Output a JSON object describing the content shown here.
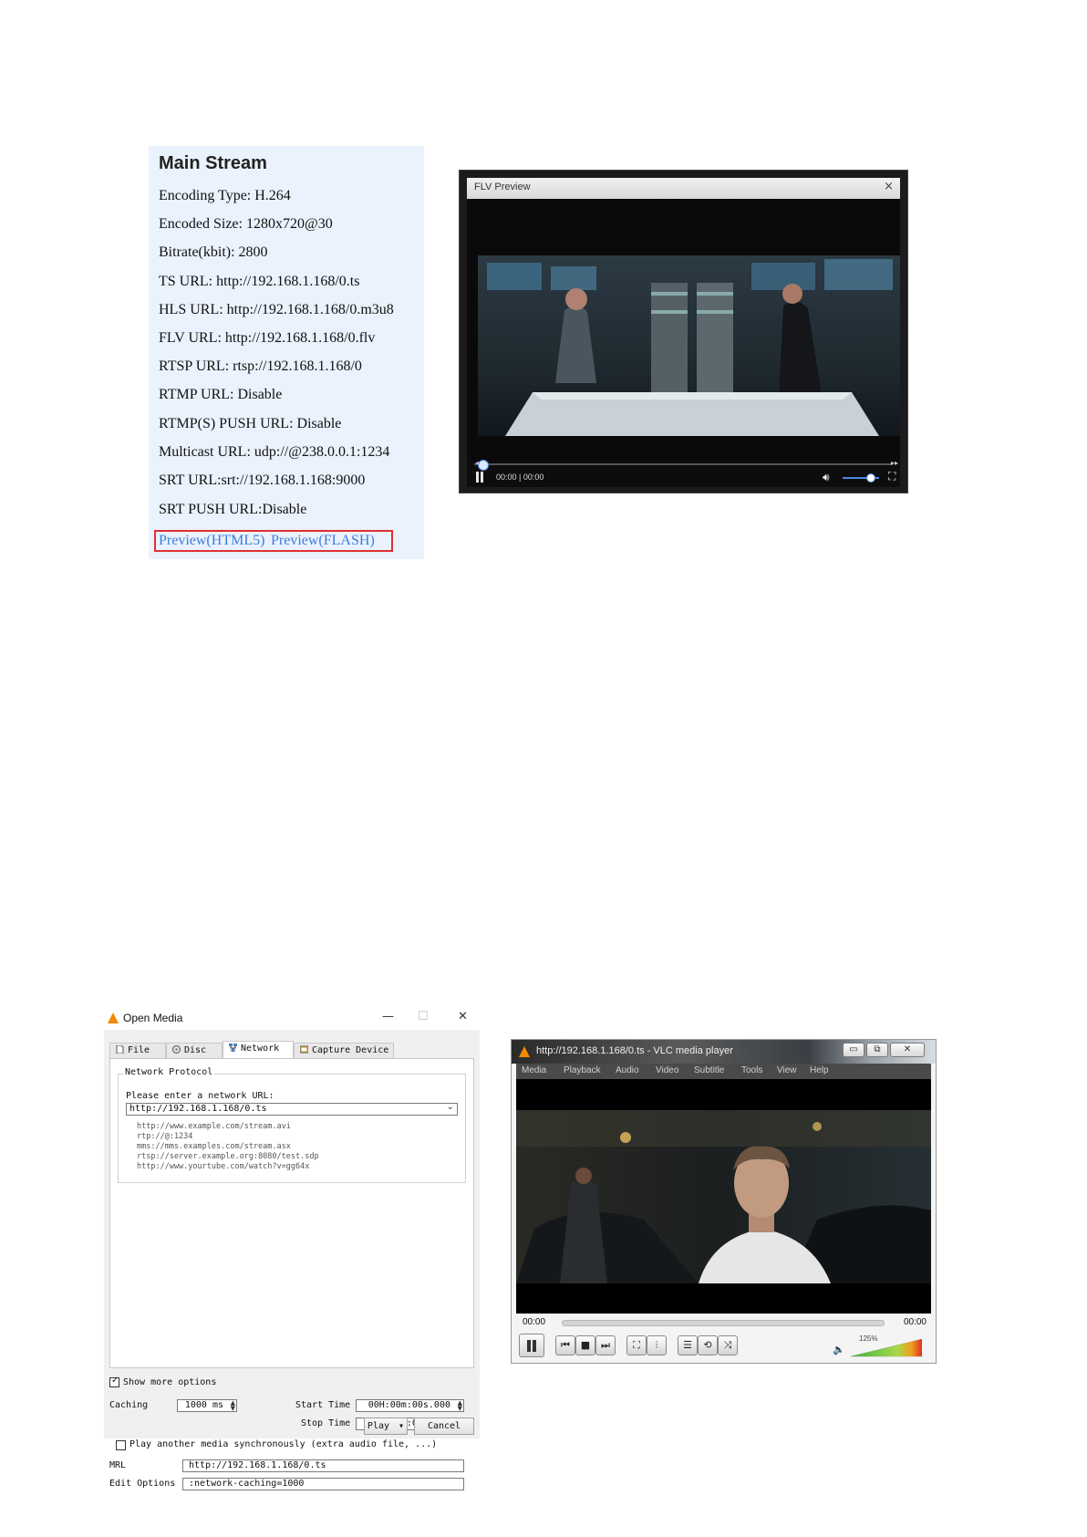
{
  "main_stream": {
    "title": "Main Stream",
    "rows": [
      "Encoding Type: H.264",
      "Encoded Size: 1280x720@30",
      "Bitrate(kbit): 2800",
      "TS URL: http://192.168.1.168/0.ts",
      "HLS URL: http://192.168.1.168/0.m3u8",
      "FLV URL: http://192.168.1.168/0.flv",
      "RTSP URL: rtsp://192.168.1.168/0",
      "RTMP URL: Disable",
      "RTMP(S) PUSH URL: Disable",
      "Multicast URL: udp://@238.0.0.1:1234",
      "SRT URL:srt://192.168.1.168:9000",
      "SRT PUSH URL:Disable"
    ],
    "preview_html5": "Preview(HTML5)",
    "preview_flash": "Preview(FLASH)",
    "highlight_color": "#e03030",
    "link_color": "#3b7dde"
  },
  "flv_preview": {
    "title": "FLV Preview",
    "close_glyph": "×",
    "time": "00:00 | 00:00",
    "volume_fraction": 0.75,
    "icons": [
      "pause-icon",
      "volume-icon",
      "fullscreen-icon"
    ]
  },
  "open_media": {
    "title": "Open Media",
    "window_buttons": {
      "minimize": "—",
      "maximize": "☐",
      "close": "✕"
    },
    "tabs": [
      {
        "label": "File",
        "icon": "file-icon"
      },
      {
        "label": "Disc",
        "icon": "disc-icon"
      },
      {
        "label": "Network",
        "icon": "network-icon",
        "active": true
      },
      {
        "label": "Capture Device",
        "icon": "capture-device-icon"
      }
    ],
    "group_title": "Network Protocol",
    "prompt": "Please enter a network URL:",
    "url_value": "http://192.168.1.168/0.ts",
    "examples": [
      "http://www.example.com/stream.avi",
      "rtp://@:1234",
      "mms://mms.examples.com/stream.asx",
      "rtsp://server.example.org:8080/test.sdp",
      "http://www.yourtube.com/watch?v=gg64x"
    ],
    "show_more_label": "Show more options",
    "show_more_checked": true,
    "caching_label": "Caching",
    "caching_value": "1000 ms",
    "start_time_label": "Start Time",
    "start_time_value": "00H:00m:00s.000",
    "stop_time_label": "Stop Time",
    "stop_time_value": "00H:00m:00s.000",
    "play_another_label": "Play another media synchronously (extra audio file, ...)",
    "play_another_checked": false,
    "mrl_label": "MRL",
    "mrl_value": "http://192.168.1.168/0.ts",
    "edit_options_label": "Edit Options",
    "edit_options_value": ":network-caching=1000",
    "play_button": "Play",
    "play_dropdown_glyph": "▾",
    "cancel_button": "Cancel"
  },
  "vlc_player": {
    "title": "http://192.168.1.168/0.ts - VLC media player",
    "window_buttons": {
      "minimize": "▭",
      "restore": "⧉",
      "close": "✕"
    },
    "menu": [
      "Media",
      "Playback",
      "Audio",
      "Video",
      "Subtitle",
      "Tools",
      "View",
      "Help"
    ],
    "time_elapsed": "00:00",
    "time_total": "00:00",
    "volume_label": "125%",
    "volume_fraction": 1.0,
    "buttons": [
      {
        "name": "previous",
        "glyph": "⏮"
      },
      {
        "name": "stop",
        "glyph": "■"
      },
      {
        "name": "next",
        "glyph": "⏭"
      },
      {
        "name": "fullscreen",
        "glyph": "⛶"
      },
      {
        "name": "extended-settings",
        "glyph": "⫶"
      },
      {
        "name": "playlist",
        "glyph": "☰"
      },
      {
        "name": "loop",
        "glyph": "⟲"
      },
      {
        "name": "shuffle",
        "glyph": "⤨"
      }
    ],
    "volume_icon": "🔈"
  }
}
